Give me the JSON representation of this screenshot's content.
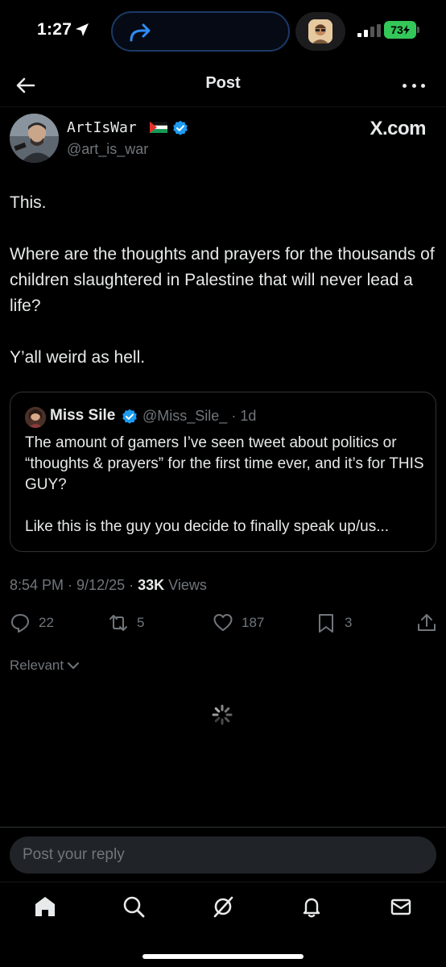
{
  "status_bar": {
    "time": "1:27",
    "battery": "73"
  },
  "header": {
    "title": "Post"
  },
  "post": {
    "author_name": "ArtIsWar",
    "author_handle": "@art_is_war",
    "source": "X.com",
    "text": "This.\n\nWhere are the thoughts and prayers for the thousands of children slaughtered in Palestine that will never lead a life?\n\nY’all weird as hell.",
    "time": "8:54 PM",
    "date": "9/12/25",
    "views_count": "33K",
    "views_label": "Views"
  },
  "quote": {
    "author_name": "Miss Sile",
    "author_handle": "@Miss_Sile_",
    "age": "1d",
    "text": "The amount of gamers I’ve seen tweet about politics or “thoughts & prayers” for the first time ever, and it’s for THIS GUY?\n\nLike this is the guy you decide to finally speak up/us..."
  },
  "actions": {
    "replies": "22",
    "reposts": "5",
    "likes": "187",
    "bookmarks": "3"
  },
  "replies_filter": "Relevant",
  "reply_box": {
    "placeholder": "Post your reply"
  },
  "icons": {
    "back": "back-arrow-icon",
    "more": "more-icon",
    "verified": "verified-badge-icon",
    "reply": "reply-icon",
    "repost": "repost-icon",
    "like": "heart-icon",
    "bookmark": "bookmark-icon",
    "share": "share-icon",
    "home": "home-icon",
    "search": "search-icon",
    "grok": "grok-icon",
    "notifications": "bell-icon",
    "messages": "mail-icon"
  },
  "colors": {
    "background": "#000000",
    "text": "#e7e9ea",
    "secondary": "#71767b",
    "verified": "#1d9bf0",
    "battery": "#34c759"
  }
}
